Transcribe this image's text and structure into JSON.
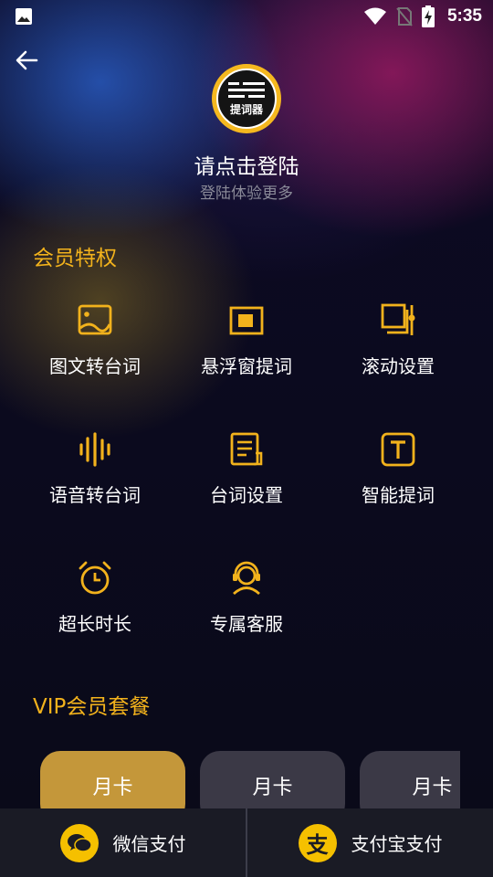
{
  "status_bar": {
    "time": "5:35"
  },
  "logo": {
    "text": "提词器"
  },
  "login": {
    "title": "请点击登陆",
    "subtitle": "登陆体验更多"
  },
  "perks_section": {
    "title": "会员特权",
    "items": [
      {
        "label": "图文转台词",
        "icon": "image-icon"
      },
      {
        "label": "悬浮窗提词",
        "icon": "floating-window-icon"
      },
      {
        "label": "滚动设置",
        "icon": "scroll-settings-icon"
      },
      {
        "label": "语音转台词",
        "icon": "voice-wave-icon"
      },
      {
        "label": "台词设置",
        "icon": "script-settings-icon"
      },
      {
        "label": "智能提词",
        "icon": "smart-text-icon"
      },
      {
        "label": "超长时长",
        "icon": "alarm-clock-icon"
      },
      {
        "label": "专属客服",
        "icon": "headset-icon"
      }
    ]
  },
  "vip_section": {
    "title": "VIP会员套餐",
    "plans": [
      {
        "label": "月卡"
      },
      {
        "label": "月卡"
      },
      {
        "label": "月卡"
      }
    ]
  },
  "payment": {
    "wechat_label": "微信支付",
    "alipay_label": "支付宝支付",
    "alipay_icon_glyph": "支"
  },
  "colors": {
    "accent": "#f2b21c",
    "plan_active": "#c4973a",
    "plan_inactive": "#3b3946",
    "pay_icon": "#f5c000"
  }
}
